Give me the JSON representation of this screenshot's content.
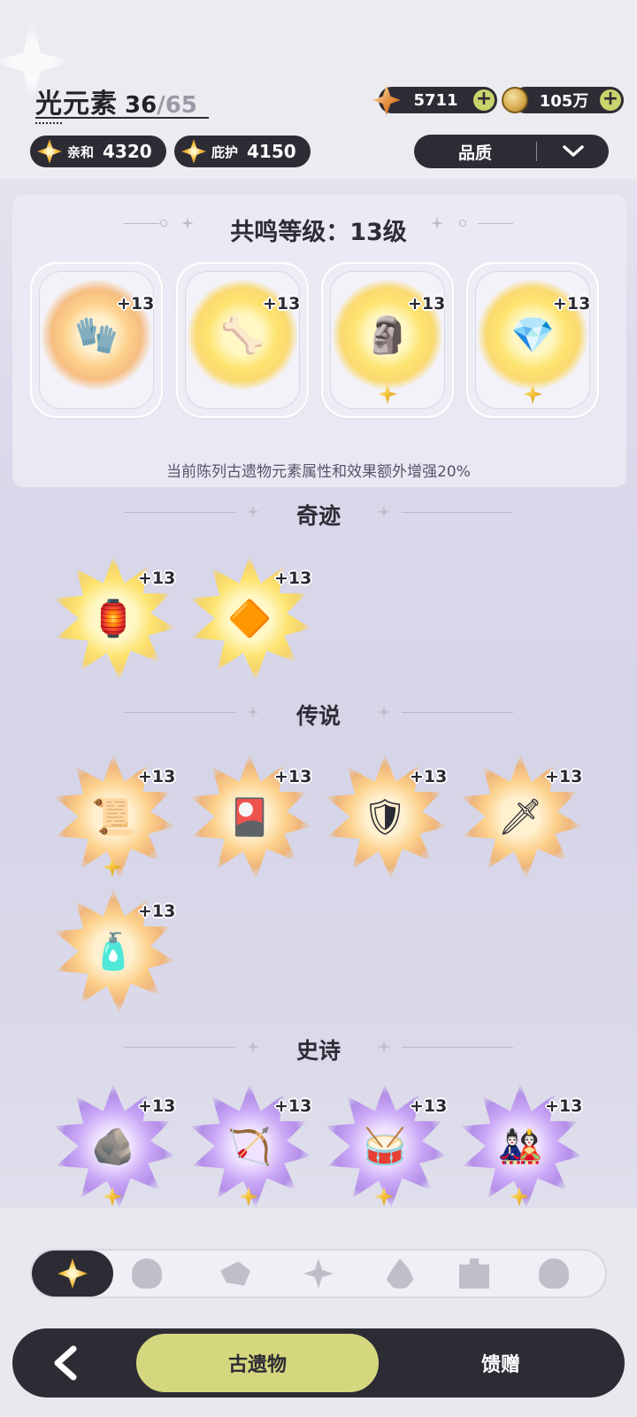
{
  "header": {
    "element_name": "光元素",
    "collected": "36",
    "slash": "/",
    "total": "65",
    "affinity": {
      "label": "亲和",
      "value": "4320"
    },
    "protection": {
      "label": "庇护",
      "value": "4150"
    },
    "gems": "5711",
    "coins": "105万",
    "quality_filter": "品质"
  },
  "resonance": {
    "title": "共鸣等级：13级",
    "desc": "当前陈列古遗物元素属性和效果额外增强20%",
    "slots": [
      {
        "icon": "glove-icon",
        "level": "+13",
        "star": false
      },
      {
        "icon": "horn-bracelet-icon",
        "level": "+13",
        "star": false
      },
      {
        "icon": "winged-statue-icon",
        "level": "+13",
        "star": true
      },
      {
        "icon": "crystal-feather-icon",
        "level": "+13",
        "star": true
      }
    ]
  },
  "sections": [
    {
      "title": "奇迹",
      "items": [
        {
          "icon": "lantern-icon",
          "level": "+13",
          "star": false,
          "tier": "gold"
        },
        {
          "icon": "octahedron-icon",
          "level": "+13",
          "star": false,
          "tier": "gold"
        }
      ]
    },
    {
      "title": "传说",
      "items": [
        {
          "icon": "scroll-wing-icon",
          "level": "+13",
          "star": true,
          "tier": "orange"
        },
        {
          "icon": "talisman-card-icon",
          "level": "+13",
          "star": false,
          "tier": "orange"
        },
        {
          "icon": "golden-armor-icon",
          "level": "+13",
          "star": false,
          "tier": "orange"
        },
        {
          "icon": "sword-icon",
          "level": "+13",
          "star": false,
          "tier": "orange"
        },
        {
          "icon": "perfume-bottle-icon",
          "level": "+13",
          "star": false,
          "tier": "orange"
        }
      ]
    },
    {
      "title": "史诗",
      "items": [
        {
          "icon": "cracked-stone-icon",
          "level": "+13",
          "star": true,
          "tier": "purple"
        },
        {
          "icon": "crossbow-icon",
          "level": "+13",
          "star": true,
          "tier": "purple"
        },
        {
          "icon": "drum-icon",
          "level": "+13",
          "star": true,
          "tier": "purple"
        },
        {
          "icon": "daruma-icon",
          "level": "+13",
          "star": true,
          "tier": "purple"
        }
      ]
    }
  ],
  "element_tabs": [
    "light-element-icon",
    "earth-element-icon",
    "wind-element-icon",
    "crystal-element-icon",
    "fire-element-icon",
    "puzzle-element-icon",
    "dark-element-icon"
  ],
  "bottom_nav": {
    "relics": "古遗物",
    "gifts": "馈赠"
  },
  "colors": {
    "dark": "#2d2c35",
    "accent": "#d5d77f",
    "plus": "#c9d46b"
  }
}
